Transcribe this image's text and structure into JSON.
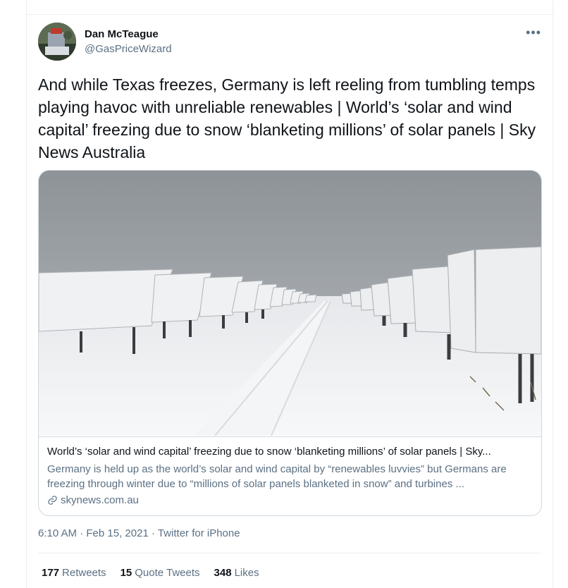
{
  "author": {
    "name": "Dan McTeague",
    "handle": "@GasPriceWizard"
  },
  "tweet": {
    "text": "And while Texas freezes, Germany is left reeling from tumbling temps playing havoc with unreliable renewables | World’s ‘solar and wind capital’ freezing due to snow ‘blanketing millions’ of solar panels | Sky News Australia",
    "more_icon": "more-horizontal-icon"
  },
  "card": {
    "title": "World’s ‘solar and wind capital’ freezing due to snow ‘blanketing millions’ of solar panels | Sky...",
    "description": "Germany is held up as the world’s solar and wind capital by “renewables luvvies” but Germans are freezing through winter due to “millions of solar panels blanketed in snow” and turbines ...",
    "domain": "skynews.com.au",
    "domain_icon": "link-icon"
  },
  "meta": {
    "time": "6:10 AM",
    "separator": " · ",
    "date": "Feb 15, 2021",
    "source": "Twitter for iPhone"
  },
  "stats": {
    "retweets_count": "177",
    "retweets_label": "Retweets",
    "quotes_count": "15",
    "quotes_label": "Quote Tweets",
    "likes_count": "348",
    "likes_label": "Likes"
  },
  "colors": {
    "text_primary": "#0f1419",
    "text_secondary": "#5b7083",
    "border": "#cfd9de"
  }
}
